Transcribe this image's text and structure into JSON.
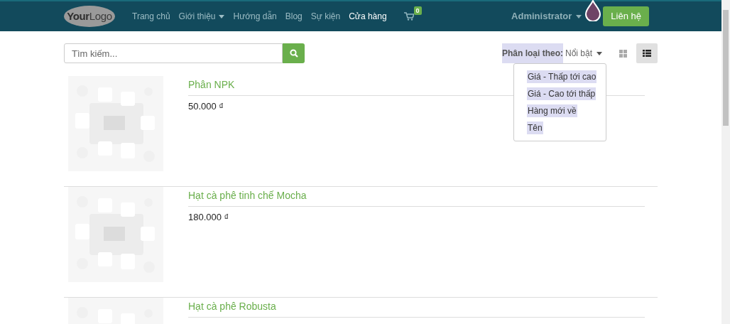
{
  "navbar": {
    "logo": {
      "word1": "Your",
      "word2": "Logo"
    },
    "items": [
      {
        "label": "Trang chủ",
        "selected": false,
        "dropdown": false
      },
      {
        "label": "Giới thiệu",
        "selected": false,
        "dropdown": true
      },
      {
        "label": "Hướng dẫn",
        "selected": false,
        "dropdown": false
      },
      {
        "label": "Blog",
        "selected": false,
        "dropdown": false
      },
      {
        "label": "Sự kiện",
        "selected": false,
        "dropdown": false
      },
      {
        "label": "Cửa hàng",
        "selected": true,
        "dropdown": false
      }
    ],
    "cart_count": "0",
    "user": "Administrator",
    "contact_button": "Liên hệ"
  },
  "search": {
    "placeholder": "Tìm kiếm..."
  },
  "sort": {
    "label": "Phân loại theo:",
    "value": "Nổi bật",
    "options": [
      "Giá - Thấp tới cao",
      "Giá - Cao tới thấp",
      "Hàng mới về",
      "Tên"
    ]
  },
  "view_toggle": [
    {
      "kind": "grid",
      "selected": false
    },
    {
      "kind": "list",
      "selected": true
    }
  ],
  "products": [
    {
      "name": "Phân NPK",
      "price": "50.000 ₫"
    },
    {
      "name": "Hạt cà phê tinh chế Mocha",
      "price": "180.000 ₫"
    },
    {
      "name": "Hạt cà phê Robusta"
    }
  ]
}
